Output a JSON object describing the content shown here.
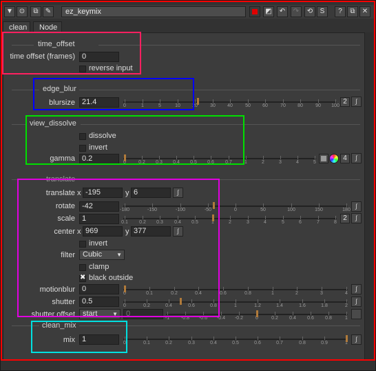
{
  "window": {
    "title": "ez_keymix",
    "accent_red": "#e00000",
    "buttons": [
      "menu-icon",
      "node-icon",
      "copy-icon",
      "wrench-icon",
      "red-square-icon",
      "gradient-icon",
      "undo-icon",
      "redo-icon",
      "revert-icon",
      "script-icon",
      "help-icon",
      "float-icon",
      "close-icon"
    ]
  },
  "tabs": [
    {
      "label": "clean"
    },
    {
      "label": "Node"
    }
  ],
  "time_offset": {
    "group": "time_offset",
    "label": "time offset (frames)",
    "value": "0",
    "reverse_label": "reverse input"
  },
  "edge_blur": {
    "group": "edge_blur",
    "label": "blursize",
    "value": "21.4",
    "ticks": [
      "0",
      "1",
      "5",
      "10",
      "20",
      "30",
      "40",
      "50",
      "60",
      "70",
      "80",
      "90",
      "100"
    ],
    "badge": "2"
  },
  "view_dissolve": {
    "group": "view_dissolve",
    "dissolve_label": "dissolve",
    "invert_label": "invert",
    "gamma_label": "gamma",
    "gamma_value": "0.2",
    "ticks": [
      "0",
      "0.2",
      "0.3",
      "0.4",
      "0.5",
      "0.6",
      "0.7",
      "1",
      "2",
      "3",
      "4",
      "5"
    ],
    "badge": "4"
  },
  "transform": {
    "group": "translate",
    "translate_label": "translate",
    "translate_x": "-195",
    "translate_y": "6",
    "rotate_label": "rotate",
    "rotate_value": "-42",
    "rotate_ticks": [
      "-180",
      "-150",
      "-100",
      "-50",
      "0",
      "50",
      "100",
      "150",
      "180"
    ],
    "scale_label": "scale",
    "scale_value": "1",
    "scale_ticks": [
      "0.1",
      "0.2",
      "0.3",
      "0.4",
      "0.5",
      "1",
      "2",
      "3",
      "4",
      "5",
      "6",
      "7",
      "8"
    ],
    "scale_badge": "2",
    "center_label": "center",
    "center_x": "969",
    "center_y": "377",
    "invert_label": "invert",
    "filter_label": "filter",
    "filter_value": "Cubic",
    "clamp_label": "clamp",
    "black_outside_label": "black outside",
    "motionblur_label": "motionblur",
    "motionblur_value": "0",
    "mb_ticks": [
      "0",
      "0.1",
      "0.2",
      "0.4",
      "0.6",
      "0.8",
      "1",
      "2",
      "3",
      "4"
    ],
    "shutter_label": "shutter",
    "shutter_value": "0.5",
    "shutter_ticks": [
      "0",
      "0.2",
      "0.4",
      "0.6",
      "0.8",
      "1",
      "1.2",
      "1.4",
      "1.6",
      "1.8",
      "2"
    ],
    "shutter_offset_label": "shutter offset",
    "shutter_offset_value": "start",
    "shutter_offset_num": "0",
    "so_ticks": [
      "-1",
      "-0.8",
      "-0.6",
      "-0.4",
      "-0.2",
      "0",
      "0.2",
      "0.4",
      "0.6",
      "0.8",
      "1"
    ]
  },
  "clean_mix": {
    "group": "clean_mix",
    "label": "mix",
    "value": "1",
    "ticks": [
      "0",
      "0.1",
      "0.2",
      "0.3",
      "0.4",
      "0.5",
      "0.6",
      "0.7",
      "0.8",
      "0.9",
      "1"
    ]
  },
  "highlight_colors": {
    "red": "#ff0000",
    "pink": "#ff2060",
    "blue": "#0000ff",
    "green": "#00e000",
    "magenta": "#e000e0",
    "cyan": "#00e0e0"
  }
}
